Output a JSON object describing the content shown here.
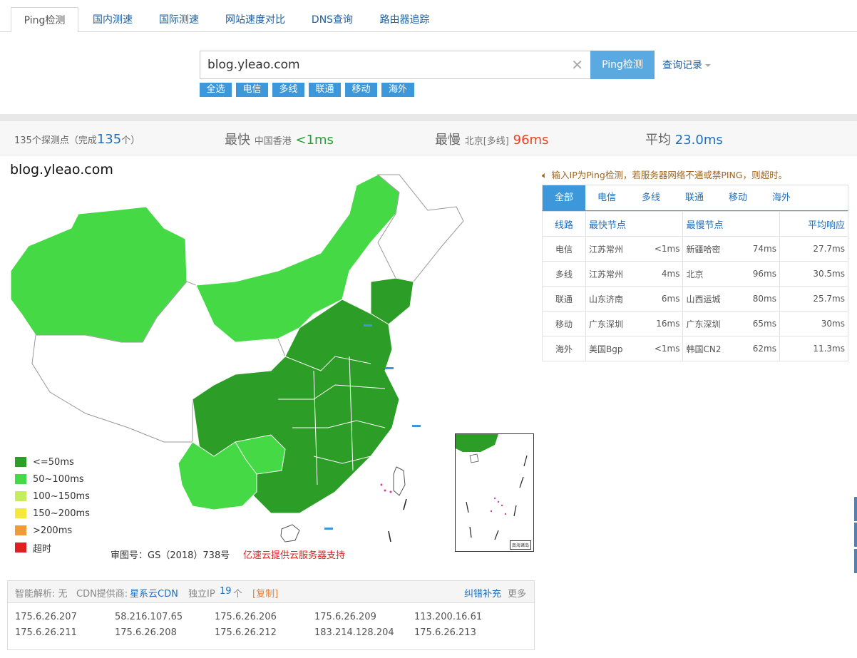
{
  "tabs": [
    "Ping检测",
    "国内测速",
    "国际测速",
    "网站速度对比",
    "DNS查询",
    "路由器追踪"
  ],
  "search": {
    "value": "blog.yleao.com",
    "button": "Ping检测",
    "history": "查询记录"
  },
  "filters": [
    "全选",
    "电信",
    "多线",
    "联通",
    "移动",
    "海外"
  ],
  "stats": {
    "count_pre": "135个探测点（完成",
    "count_num": "135",
    "count_post": "个）",
    "fast_label": "最快",
    "fast_loc": "中国香港",
    "fast_val": "<1ms",
    "slow_label": "最慢",
    "slow_loc": "北京[多线]",
    "slow_val": "96ms",
    "avg_label": "平均",
    "avg_val": "23.0ms"
  },
  "map": {
    "title": "blog.yleao.com",
    "approval": "审图号：GS（2018）738号",
    "support": "亿速云提供云服务器支持",
    "inset_label": "南海诸岛"
  },
  "legend": [
    {
      "label": "<=50ms",
      "color": "#2c9e27"
    },
    {
      "label": "50~100ms",
      "color": "#45d945"
    },
    {
      "label": "100~150ms",
      "color": "#c4ee5e"
    },
    {
      "label": "150~200ms",
      "color": "#f5e83a"
    },
    {
      "label": ">200ms",
      "color": "#f09a3a"
    },
    {
      "label": "超时",
      "color": "#e02020"
    }
  ],
  "notice": "输入IP为Ping检测，若服务器网络不通或禁PING，则超时。",
  "isp_tabs": [
    "全部",
    "电信",
    "多线",
    "联通",
    "移动",
    "海外"
  ],
  "results": {
    "headers": [
      "线路",
      "最快节点",
      "最慢节点",
      "平均响应"
    ],
    "rows": [
      {
        "line": "电信",
        "fast": "江苏常州",
        "fast_ms": "<1ms",
        "slow": "新疆哈密",
        "slow_ms": "74ms",
        "avg": "27.7ms"
      },
      {
        "line": "多线",
        "fast": "江苏常州",
        "fast_ms": "4ms",
        "slow": "北京",
        "slow_ms": "96ms",
        "avg": "30.5ms"
      },
      {
        "line": "联通",
        "fast": "山东济南",
        "fast_ms": "6ms",
        "slow": "山西运城",
        "slow_ms": "80ms",
        "avg": "25.7ms"
      },
      {
        "line": "移动",
        "fast": "广东深圳",
        "fast_ms": "16ms",
        "slow": "广东深圳",
        "slow_ms": "65ms",
        "avg": "30ms"
      },
      {
        "line": "海外",
        "fast": "美国Bgp",
        "fast_ms": "<1ms",
        "slow": "韩国CN2",
        "slow_ms": "62ms",
        "avg": "11.3ms"
      }
    ]
  },
  "dns": {
    "smart": "智能解析: 无",
    "cdn_label": "CDN提供商:",
    "cdn_value": "星系云CDN",
    "ip_label": "独立IP",
    "ip_count": "19",
    "ip_unit": "个",
    "copy": "[复制]",
    "report": "纠错补充",
    "more": "更多",
    "ips": [
      "175.6.26.207",
      "58.216.107.65",
      "175.6.26.206",
      "175.6.26.209",
      "113.200.16.61",
      "175.6.26.211",
      "175.6.26.208",
      "175.6.26.212",
      "183.214.128.204",
      "175.6.26.213"
    ]
  },
  "colors": {
    "accent": "#3c97db",
    "dark_green": "#2c9e27",
    "light_green": "#45d945",
    "fast": "#23a13b",
    "slow": "#e8421f"
  }
}
